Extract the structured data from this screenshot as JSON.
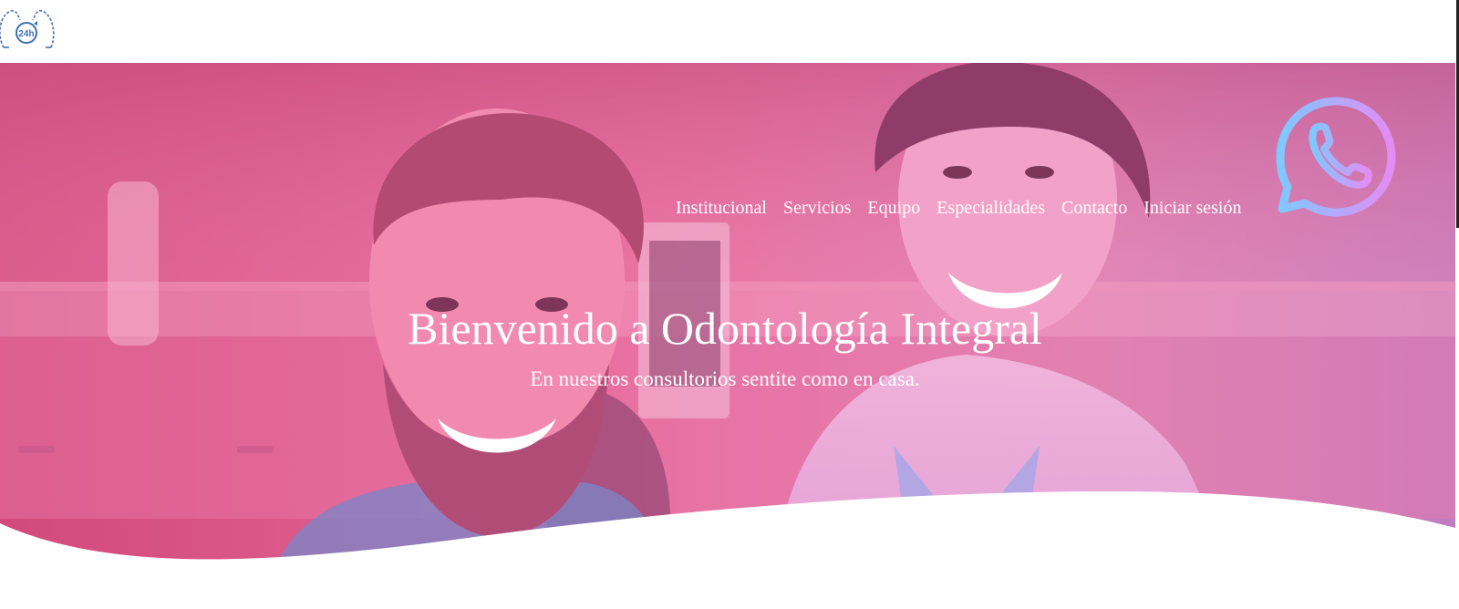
{
  "brand": {
    "logo_text": "24h"
  },
  "nav": {
    "items": [
      {
        "label": "Institucional"
      },
      {
        "label": "Servicios"
      },
      {
        "label": "Equipo"
      },
      {
        "label": "Especialidades"
      },
      {
        "label": "Contacto"
      },
      {
        "label": "Iniciar sesión"
      }
    ]
  },
  "hero": {
    "title": "Bienvenido a Odontología Integral",
    "subtitle": "En nuestros consultorios sentite como en casa.",
    "overlay_color": "#e85a9a"
  },
  "whatsapp": {
    "icon": "whatsapp-icon",
    "gradient_start": "#7fc8ff",
    "gradient_end": "#e48cf5"
  },
  "colors": {
    "logo": "#3f6fb0",
    "hero_left": "#d5507f",
    "hero_right": "#cf7fc4"
  }
}
